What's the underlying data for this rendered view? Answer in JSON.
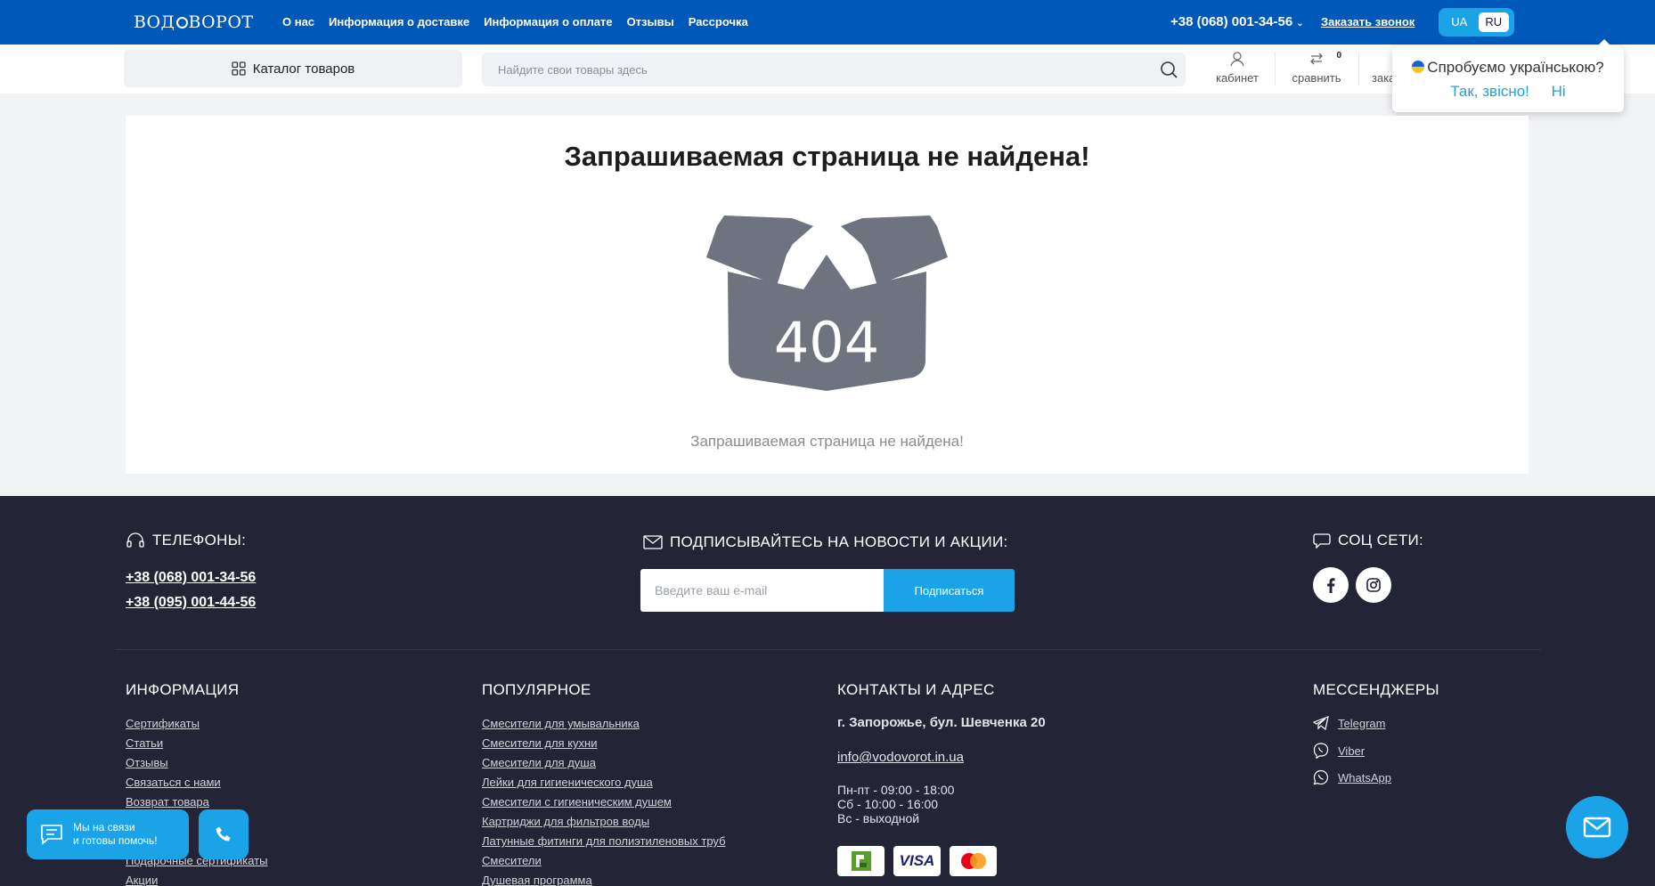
{
  "header": {
    "logo_text": "ВОДОВОРОТ",
    "nav": [
      "О нас",
      "Информация о доставке",
      "Информация о оплате",
      "Отзывы",
      "Рассрочка"
    ],
    "phone": "+38 (068) 001-34-56",
    "callback_label": "Заказать звонок",
    "languages": [
      "UA",
      "RU"
    ],
    "active_language": "RU"
  },
  "toolbar": {
    "catalog_label": "Каталог товаров",
    "search_placeholder": "Найдите свои товары здесь",
    "cabinet_label": "кабинет",
    "compare_label": "сравнить",
    "compare_count": "0",
    "orders_label": "зака"
  },
  "lang_popup": {
    "question": "Спробуємо українською?",
    "yes": "Так, звісно!",
    "no": "Ні"
  },
  "main": {
    "title": "Запрашиваемая страница не найдена!",
    "code": "404",
    "message": "Запрашиваемая страница не найдена!"
  },
  "footer": {
    "phones_title": "ТЕЛЕФОНЫ:",
    "phones": [
      "+38 (068) 001-34-56",
      "+38 (095) 001-44-56"
    ],
    "subscribe_title": "ПОДПИСЫВАЙТЕСЬ НА НОВОСТИ И АКЦИИ:",
    "email_placeholder": "Введите ваш e-mail",
    "subscribe_button": "Подписаться",
    "social_title": "СОЦ СЕТИ:",
    "info_title": "ИНФОРМАЦИЯ",
    "info_links": [
      "Сертификаты",
      "Статьи",
      "Отзывы",
      "Связаться с нами",
      "Возврат товара",
      "",
      "",
      "Подарочные сертификаты",
      "Акции"
    ],
    "popular_title": "ПОПУЛЯРНОЕ",
    "popular_links": [
      "Смесители для умывальника",
      "Смесители для кухни",
      "Смесители для душа",
      "Лейки для гигиенического душа",
      "Смесители с гигиеническим душем",
      "Картриджи для фильтров воды",
      "Латунные фитинги для полиэтиленовых труб",
      "Смесители",
      "Душевая программа"
    ],
    "contacts_title": "КОНТАКТЫ И АДРЕС",
    "address": "г. Запорожье, бул. Шевченка 20",
    "email": "info@vodovorot.in.ua",
    "hours": [
      "Пн-пт - 09:00 - 18:00",
      "Сб - 10:00 - 16:00",
      "Вс - выходной"
    ],
    "payment": [
      "Privat",
      "VISA",
      "Mastercard"
    ],
    "messengers_title": "МЕССЕНДЖЕРЫ",
    "messengers": [
      "Telegram",
      "Viber",
      "WhatsApp"
    ]
  },
  "widgets": {
    "chat_line1": "Мы на связи",
    "chat_line2": "и готовы помочь!"
  },
  "colors": {
    "topbar": "#0058b8",
    "accent": "#1aa3e6",
    "footer": "#232536",
    "box": "#6f727f"
  }
}
